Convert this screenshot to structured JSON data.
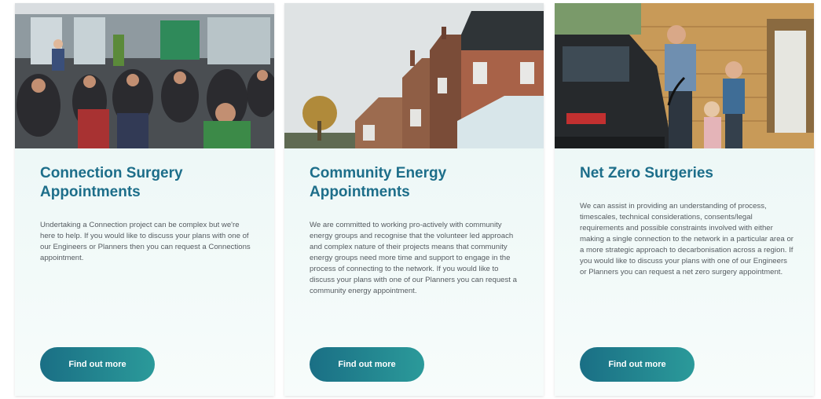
{
  "cards": [
    {
      "title": "Connection Surgery Appointments",
      "text": "Undertaking a Connection project can be complex but we're here to help. If you would like to discuss your plans with one of our Engineers or Planners then you can request a Connections appointment.",
      "button_label": "Find out more"
    },
    {
      "title": "Community Energy Appointments",
      "text": "We are committed to working pro-actively with community energy groups and recognise that the volunteer led approach and complex nature of their projects means that community energy groups need more time and support to engage in the process of connecting to the network. If you would like to discuss your plans with one of our Planners you can request a community energy appointment.",
      "button_label": "Find out more"
    },
    {
      "title": "Net Zero Surgeries",
      "text": "We can assist in providing an understanding of process, timescales, technical considerations, consents/legal requirements and possible constraints involved with either making a single connection to the network in a particular area or a more strategic approach to decarbonisation across a region. If you would like to discuss your plans with one of our Engineers or Planners you can request a net zero surgery appointment.",
      "button_label": "Find out more"
    }
  ],
  "colors": {
    "title": "#1d6e8a",
    "body_text": "#555b60",
    "button_start": "#1a6f85",
    "button_end": "#2b9a9a",
    "card_background": "#e3f2f1"
  }
}
